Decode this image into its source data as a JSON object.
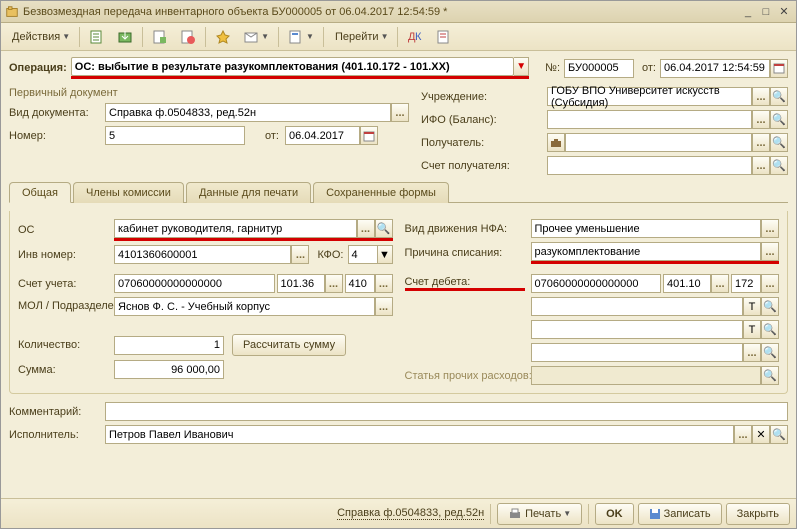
{
  "titlebar": {
    "title": "Безвозмездная передача инвентарного объекта БУ000005 от 06.04.2017 12:54:59 *"
  },
  "toolbar": {
    "actions": "Действия",
    "goto": "Перейти"
  },
  "top": {
    "operation_lbl": "Операция:",
    "operation_val": "ОС: выбытие в результате разукомплектования (401.10.172 - 101.ХХ)",
    "num_lbl": "№:",
    "num_val": "БУ000005",
    "from_lbl": "от:",
    "date_val": "06.04.2017 12:54:59"
  },
  "primary_doc": {
    "heading": "Первичный документ",
    "viddok_lbl": "Вид документа:",
    "viddok_val": "Справка ф.0504833, ред.52н",
    "nomer_lbl": "Номер:",
    "nomer_val": "5",
    "ot_lbl": "от:",
    "ot_val": "06.04.2017"
  },
  "right_top": {
    "uchr_lbl": "Учреждение:",
    "uchr_val": "ГОБУ ВПО Университет искусств (Субсидия)",
    "ifo_lbl": "ИФО (Баланс):",
    "pol_lbl": "Получатель:",
    "schet_lbl": "Счет получателя:"
  },
  "tabs": {
    "t1": "Общая",
    "t2": "Члены комиссии",
    "t3": "Данные для печати",
    "t4": "Сохраненные формы"
  },
  "general": {
    "os_lbl": "ОС",
    "os_val": "кабинет руководителя, гарнитур",
    "inv_lbl": "Инв номер:",
    "inv_val": "4101360600001",
    "kfo_lbl": "КФО:",
    "kfo_val": "4",
    "schet_lbl": "Счет учета:",
    "schet_val1": "07060000000000000",
    "schet_val2": "101.36",
    "schet_val3": "410",
    "mol_lbl": "МОЛ / Подразделение:",
    "mol_val": "Яснов Ф. С. - Учебный корпус",
    "qty_lbl": "Количество:",
    "qty_val": "1",
    "calc_btn": "Рассчитать сумму",
    "sum_lbl": "Сумма:",
    "sum_val": "96 000,00",
    "vid_lbl": "Вид движения НФА:",
    "vid_val": "Прочее уменьшение",
    "prichina_lbl": "Причина списания:",
    "prichina_val": "разукомплектование",
    "debet_lbl": "Счет дебета:",
    "debet_v1": "07060000000000000",
    "debet_v2": "401.10",
    "debet_v3": "172",
    "statya_lbl": "Статья прочих расходов:"
  },
  "bottom": {
    "komm_lbl": "Комментарий:",
    "isp_lbl": "Исполнитель:",
    "isp_val": "Петров Павел Иванович"
  },
  "footer": {
    "spravka": "Справка ф.0504833, ред.52н",
    "pechat": "Печать",
    "ok": "OK",
    "zapisat": "Записать",
    "zakryt": "Закрыть"
  },
  "dots": "...",
  "t_char": "T"
}
